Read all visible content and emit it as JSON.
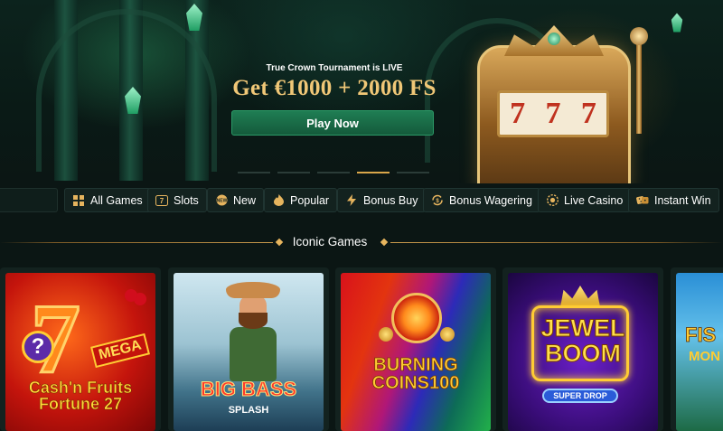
{
  "hero": {
    "tag": "True Crown Tournament is LIVE",
    "title": "Get €1000 + 2000 FS",
    "cta": "Play Now",
    "slides_total": 5,
    "active_slide": 4
  },
  "categories": [
    {
      "label": "All Games",
      "icon": "grid-icon"
    },
    {
      "label": "Slots",
      "icon": "slot-777-icon"
    },
    {
      "label": "New",
      "icon": "new-badge-icon"
    },
    {
      "label": "Popular",
      "icon": "fire-icon"
    },
    {
      "label": "Bonus Buy",
      "icon": "lightning-icon"
    },
    {
      "label": "Bonus Wagering",
      "icon": "wager-icon"
    },
    {
      "label": "Live Casino",
      "icon": "chip-icon"
    },
    {
      "label": "Instant Win",
      "icon": "dice-icon"
    }
  ],
  "section": {
    "title": "Iconic Games"
  },
  "games": [
    {
      "title": "Cash'n Fruits Fortune 27",
      "badge": "MEGA"
    },
    {
      "title": "BIG BASS",
      "subtitle": "SPLASH"
    },
    {
      "title": "BURNING COINS100"
    },
    {
      "title": "JEWEL BOOM",
      "subtitle": "SUPER DROP"
    },
    {
      "title": "FIS",
      "subtitle": "MON"
    }
  ],
  "colors": {
    "accent_gold": "#f0c777",
    "cta_green": "#1f7d53",
    "background": "#0b1614"
  }
}
